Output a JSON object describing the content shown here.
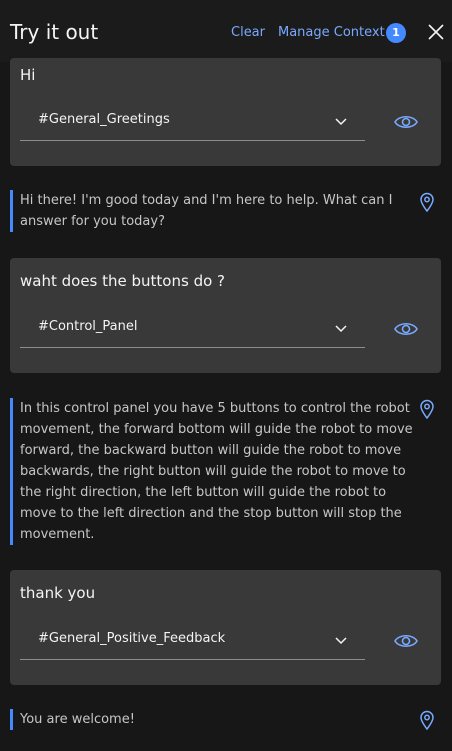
{
  "header": {
    "title": "Try it out",
    "clear_label": "Clear",
    "manage_context_label": "Manage Context",
    "context_count": "1"
  },
  "conversation": [
    {
      "user_text": "Hi",
      "intent": "#General_Greetings",
      "response": "Hi there! I'm good today and I'm here to help. What can I answer for you today?"
    },
    {
      "user_text": "waht does the buttons do ?",
      "intent": "#Control_Panel",
      "response": "In this control panel you have 5 buttons to control the robot movement, the forward bottom will guide the robot to move forward, the backward button will guide the robot to move backwards, the right button will guide the robot to move to the right direction, the left button will guide the robot to move to the left direction and the stop button will stop the movement."
    },
    {
      "user_text": "thank you",
      "intent": "#General_Positive_Feedback",
      "response": "You are welcome!"
    }
  ],
  "colors": {
    "accent": "#78a9ff",
    "badge": "#4589ff",
    "card": "#393939",
    "background": "#171717"
  },
  "icons": {
    "close": "close-icon",
    "chevron": "chevron-down-icon",
    "eye": "eye-icon",
    "pin": "location-pin-icon"
  }
}
